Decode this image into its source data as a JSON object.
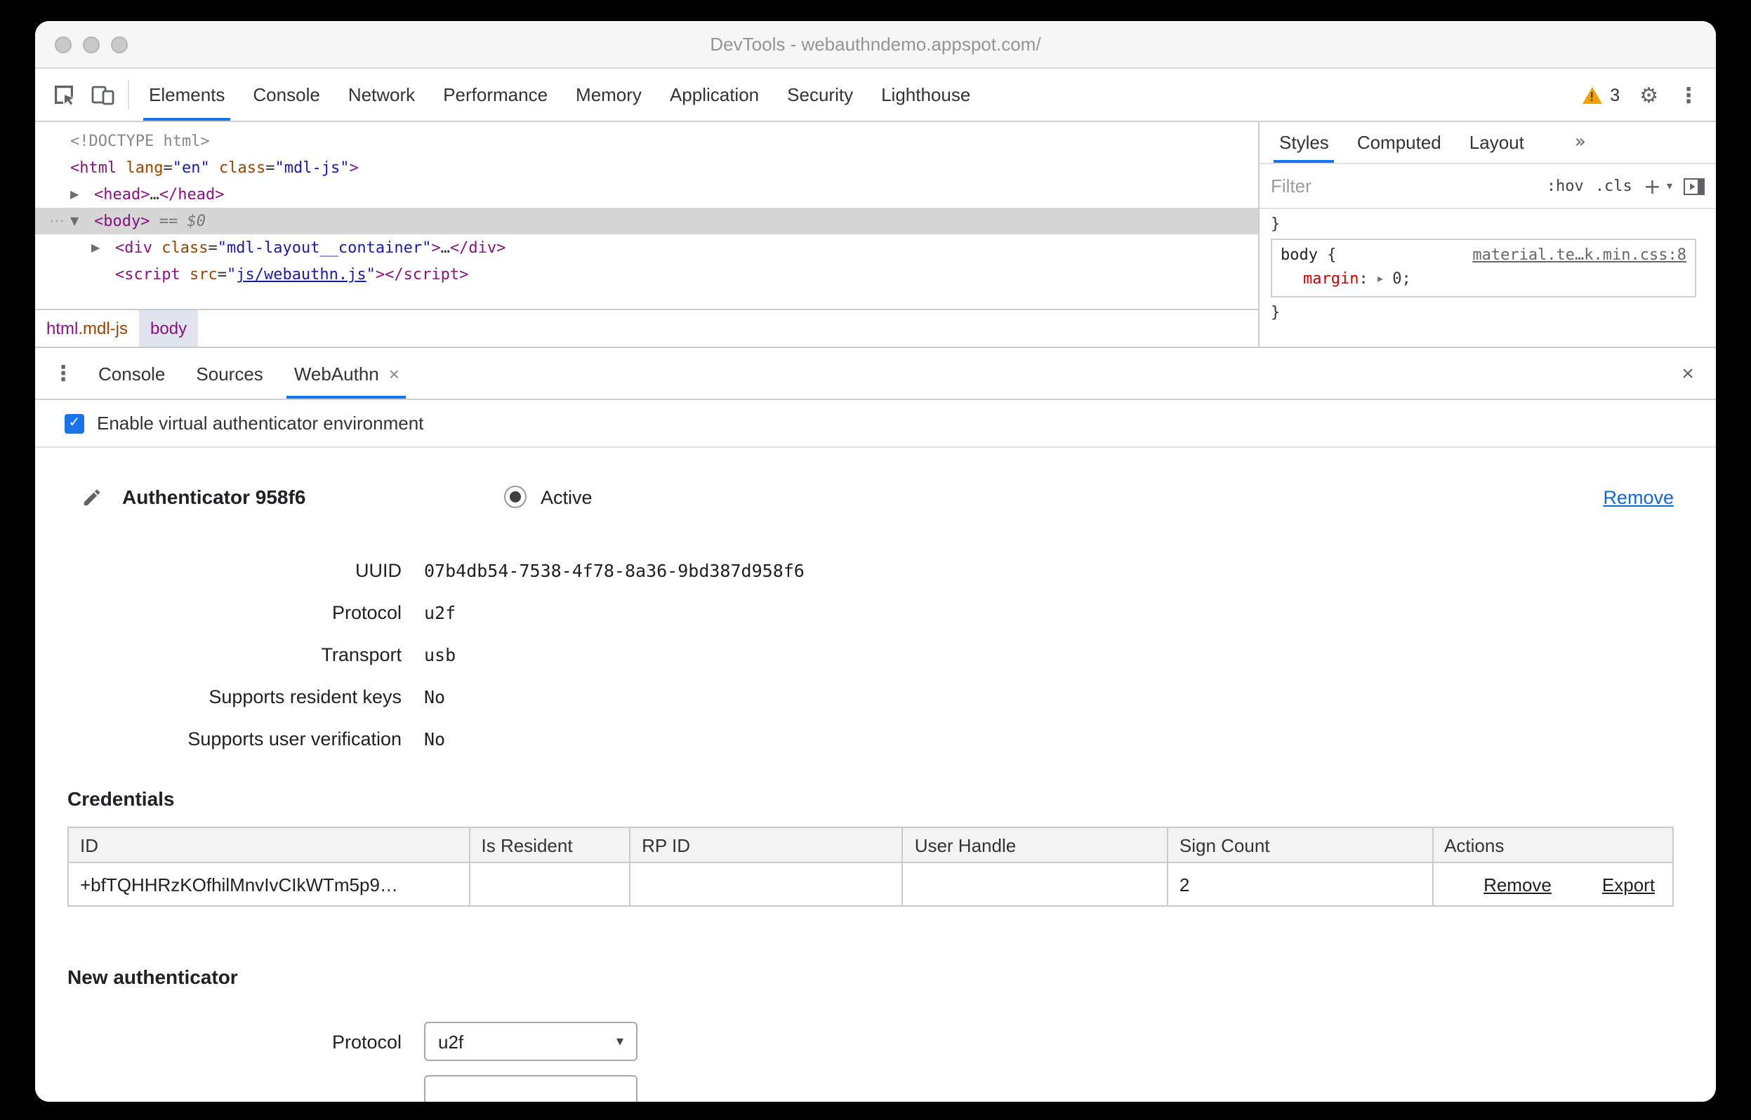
{
  "window": {
    "title": "DevTools - webauthndemo.appspot.com/"
  },
  "icons": {
    "warning_mark": "!",
    "gear": "⚙",
    "menu_dots_v": "⋮",
    "gutter_dots": "⋯",
    "arrow_right": "▶",
    "arrow_down": "▼",
    "arrow_expand": "▸",
    "close": "×",
    "tab_close": "×",
    "plus": "+",
    "caret_down": "▾",
    "check": "✓",
    "more_tabs": "»"
  },
  "toolbar": {
    "tabs": [
      "Elements",
      "Console",
      "Network",
      "Performance",
      "Memory",
      "Application",
      "Security",
      "Lighthouse"
    ],
    "warning_count": "3"
  },
  "elements_panel": {
    "tokens": {
      "eq": "=",
      "quote": "\"",
      "gt": ">",
      "ellipsis": "…",
      "sel_eq": "==",
      "sel_var": "$0"
    },
    "doctype": "<!DOCTYPE html>",
    "html_line": {
      "tag_open": "<html",
      "attr1": "lang",
      "val1": "\"en\"",
      "attr2": "class",
      "val2": "\"mdl-js\""
    },
    "head_line": {
      "open": "<head>",
      "close": "</head>"
    },
    "body_line": {
      "open": "<body>"
    },
    "div_line": {
      "tag_open": "<div",
      "attr": "class",
      "val": "\"mdl-layout__container\"",
      "close_tag": "</div>"
    },
    "script_line": {
      "tag_open": "<script",
      "attr": "src",
      "link": "js/webauthn.js",
      "close_tag": "</script>"
    },
    "breadcrumbs": {
      "crumb1_tag": "html",
      "crumb1_class": ".mdl-js",
      "crumb2": "body"
    }
  },
  "styles_panel": {
    "tabs": [
      "Styles",
      "Computed",
      "Layout"
    ],
    "filter_placeholder": "Filter",
    "pseudo_toggle": ":hov",
    "class_toggle": ".cls",
    "brace_close": "}",
    "rule": {
      "selector": "body",
      "brace_open": "{",
      "source_link": "material.te…k.min.css:8",
      "property": "margin",
      "colon": ":",
      "value": "0;"
    }
  },
  "drawer": {
    "tabs": [
      "Console",
      "Sources",
      "WebAuthn"
    ],
    "checkbox_label": "Enable virtual authenticator environment",
    "authenticator": {
      "title": "Authenticator 958f6",
      "radio_label": "Active",
      "remove_label": "Remove",
      "fields": [
        {
          "label": "UUID",
          "value": "07b4db54-7538-4f78-8a36-9bd387d958f6"
        },
        {
          "label": "Protocol",
          "value": "u2f"
        },
        {
          "label": "Transport",
          "value": "usb"
        },
        {
          "label": "Supports resident keys",
          "value": "No"
        },
        {
          "label": "Supports user verification",
          "value": "No"
        }
      ]
    },
    "credentials": {
      "heading": "Credentials",
      "columns": [
        "ID",
        "Is Resident",
        "RP ID",
        "User Handle",
        "Sign Count",
        "Actions"
      ],
      "row": {
        "id": "+bfTQHHRzKOfhilMnvIvCIkWTm5p9…",
        "is_resident": "",
        "rp_id": "",
        "user_handle": "",
        "sign_count": "2",
        "remove_label": "Remove",
        "export_label": "Export"
      }
    },
    "new_authenticator": {
      "heading": "New authenticator",
      "protocol_label": "Protocol",
      "protocol_value": "u2f"
    }
  },
  "colors": {
    "accent": "#1a73e8",
    "tag": "#881280",
    "attribute": "#994500",
    "value": "#1a1aa6",
    "css_property": "#c80000",
    "warning": "#f0a10a",
    "selected_row": "#d6d6d6"
  }
}
